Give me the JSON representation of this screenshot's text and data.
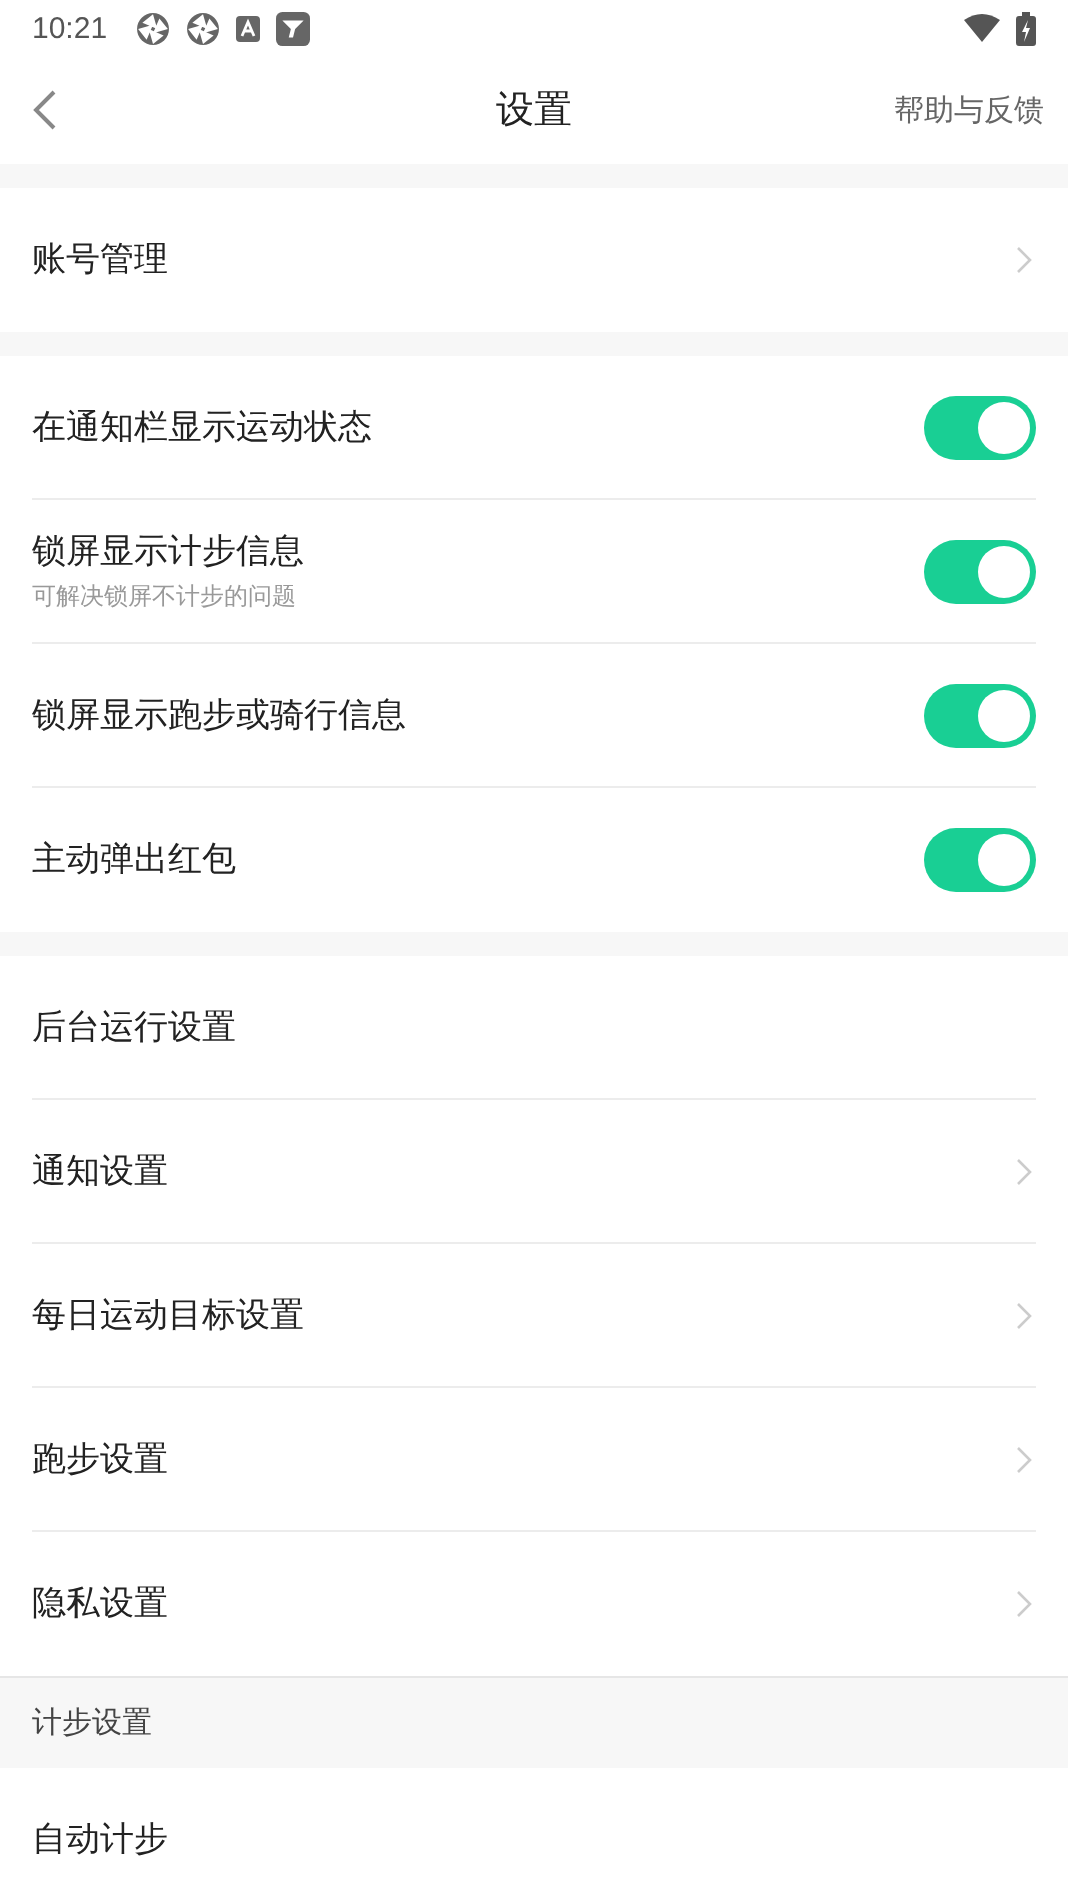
{
  "status_bar": {
    "time": "10:21"
  },
  "header": {
    "title": "设置",
    "action": "帮助与反馈"
  },
  "groups": [
    {
      "items": [
        {
          "kind": "nav",
          "label": "账号管理",
          "arrow": true
        }
      ]
    },
    {
      "items": [
        {
          "kind": "toggle",
          "label": "在通知栏显示运动状态",
          "on": true
        },
        {
          "kind": "toggle",
          "label": "锁屏显示计步信息",
          "subtitle": "可解决锁屏不计步的问题",
          "on": true
        },
        {
          "kind": "toggle",
          "label": "锁屏显示跑步或骑行信息",
          "on": true
        },
        {
          "kind": "toggle",
          "label": "主动弹出红包",
          "on": true
        }
      ]
    },
    {
      "items": [
        {
          "kind": "nav",
          "label": "后台运行设置",
          "arrow": false
        },
        {
          "kind": "nav",
          "label": "通知设置",
          "arrow": true
        },
        {
          "kind": "nav",
          "label": "每日运动目标设置",
          "arrow": true
        },
        {
          "kind": "nav",
          "label": "跑步设置",
          "arrow": true
        },
        {
          "kind": "nav",
          "label": "隐私设置",
          "arrow": true
        }
      ]
    },
    {
      "title": "计步设置",
      "items": [
        {
          "kind": "nav",
          "label": "自动计步",
          "arrow": false
        }
      ]
    }
  ]
}
